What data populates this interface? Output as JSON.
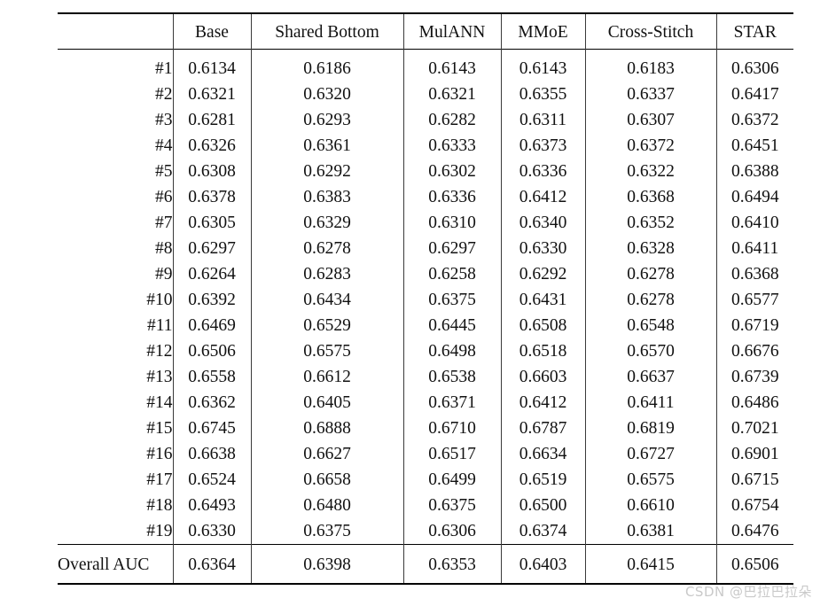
{
  "table": {
    "row_header_label": "",
    "columns": [
      "Base",
      "Shared Bottom",
      "MulANN",
      "MMoE",
      "Cross-Stitch",
      "STAR"
    ],
    "highlight_column": "STAR",
    "rows": [
      {
        "label": "#1",
        "values": [
          "0.6134",
          "0.6186",
          "0.6143",
          "0.6143",
          "0.6183",
          "0.6306"
        ]
      },
      {
        "label": "#2",
        "values": [
          "0.6321",
          "0.6320",
          "0.6321",
          "0.6355",
          "0.6337",
          "0.6417"
        ]
      },
      {
        "label": "#3",
        "values": [
          "0.6281",
          "0.6293",
          "0.6282",
          "0.6311",
          "0.6307",
          "0.6372"
        ]
      },
      {
        "label": "#4",
        "values": [
          "0.6326",
          "0.6361",
          "0.6333",
          "0.6373",
          "0.6372",
          "0.6451"
        ]
      },
      {
        "label": "#5",
        "values": [
          "0.6308",
          "0.6292",
          "0.6302",
          "0.6336",
          "0.6322",
          "0.6388"
        ]
      },
      {
        "label": "#6",
        "values": [
          "0.6378",
          "0.6383",
          "0.6336",
          "0.6412",
          "0.6368",
          "0.6494"
        ]
      },
      {
        "label": "#7",
        "values": [
          "0.6305",
          "0.6329",
          "0.6310",
          "0.6340",
          "0.6352",
          "0.6410"
        ]
      },
      {
        "label": "#8",
        "values": [
          "0.6297",
          "0.6278",
          "0.6297",
          "0.6330",
          "0.6328",
          "0.6411"
        ]
      },
      {
        "label": "#9",
        "values": [
          "0.6264",
          "0.6283",
          "0.6258",
          "0.6292",
          "0.6278",
          "0.6368"
        ]
      },
      {
        "label": "#10",
        "values": [
          "0.6392",
          "0.6434",
          "0.6375",
          "0.6431",
          "0.6278",
          "0.6577"
        ]
      },
      {
        "label": "#11",
        "values": [
          "0.6469",
          "0.6529",
          "0.6445",
          "0.6508",
          "0.6548",
          "0.6719"
        ]
      },
      {
        "label": "#12",
        "values": [
          "0.6506",
          "0.6575",
          "0.6498",
          "0.6518",
          "0.6570",
          "0.6676"
        ]
      },
      {
        "label": "#13",
        "values": [
          "0.6558",
          "0.6612",
          "0.6538",
          "0.6603",
          "0.6637",
          "0.6739"
        ]
      },
      {
        "label": "#14",
        "values": [
          "0.6362",
          "0.6405",
          "0.6371",
          "0.6412",
          "0.6411",
          "0.6486"
        ]
      },
      {
        "label": "#15",
        "values": [
          "0.6745",
          "0.6888",
          "0.6710",
          "0.6787",
          "0.6819",
          "0.7021"
        ]
      },
      {
        "label": "#16",
        "values": [
          "0.6638",
          "0.6627",
          "0.6517",
          "0.6634",
          "0.6727",
          "0.6901"
        ]
      },
      {
        "label": "#17",
        "values": [
          "0.6524",
          "0.6658",
          "0.6499",
          "0.6519",
          "0.6575",
          "0.6715"
        ]
      },
      {
        "label": "#18",
        "values": [
          "0.6493",
          "0.6480",
          "0.6375",
          "0.6500",
          "0.6610",
          "0.6754"
        ]
      },
      {
        "label": "#19",
        "values": [
          "0.6330",
          "0.6375",
          "0.6306",
          "0.6374",
          "0.6381",
          "0.6476"
        ]
      }
    ],
    "summary_row": {
      "label": "Overall AUC",
      "values": [
        "0.6364",
        "0.6398",
        "0.6353",
        "0.6403",
        "0.6415",
        "0.6506"
      ]
    }
  },
  "watermark": {
    "text": "CSDN @巴拉巴拉朵"
  }
}
